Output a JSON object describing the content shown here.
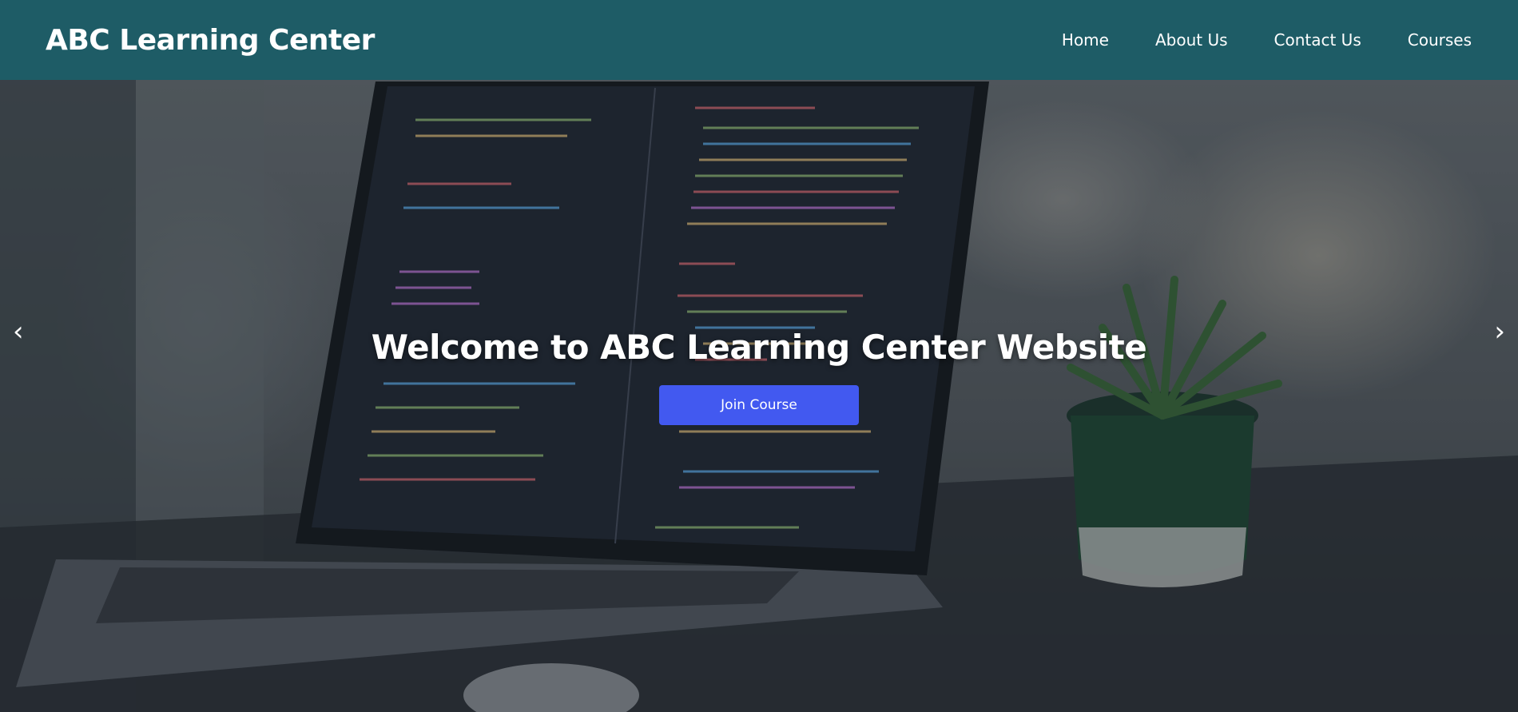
{
  "header": {
    "brand": "ABC Learning Center",
    "nav": [
      "Home",
      "About Us",
      "Contact Us",
      "Courses"
    ]
  },
  "hero": {
    "title": "Welcome to ABC Learning Center Website",
    "button_label": "Join Course",
    "prev_icon": "‹",
    "next_icon": "›",
    "background_description_icon": "laptop-with-code-and-plant-image"
  },
  "colors": {
    "header_bg": "#1e5c66",
    "button_bg": "#4259f0",
    "text": "#ffffff"
  }
}
